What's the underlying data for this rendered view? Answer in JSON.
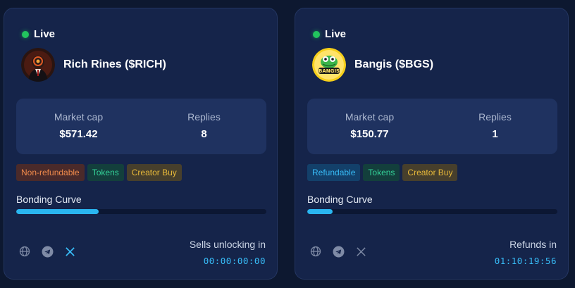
{
  "cards": [
    {
      "live_label": "Live",
      "name": "Rich Rines ($RICH)",
      "avatar_icon": "rich-rines-avatar",
      "stats": {
        "market_cap_label": "Market cap",
        "market_cap": "$571.42",
        "replies_label": "Replies",
        "replies": "8"
      },
      "tags": [
        {
          "label": "Non-refundable",
          "color": "#f08a4b"
        },
        {
          "label": "Tokens",
          "color": "#34d399"
        },
        {
          "label": "Creator Buy",
          "color": "#e8b93a"
        }
      ],
      "bonding_curve_label": "Bonding Curve",
      "bonding_curve_progress": 0.33,
      "socials": [
        "globe-icon",
        "telegram-icon",
        "x-icon"
      ],
      "x_icon_active": true,
      "timer_label": "Sells unlocking in",
      "timer": "00:00:00:00"
    },
    {
      "live_label": "Live",
      "name": "Bangis ($BGS)",
      "avatar_icon": "bangis-avatar",
      "avatar_text": "BANGIS",
      "stats": {
        "market_cap_label": "Market cap",
        "market_cap": "$150.77",
        "replies_label": "Replies",
        "replies": "1"
      },
      "tags": [
        {
          "label": "Refundable",
          "color": "#38bdf8"
        },
        {
          "label": "Tokens",
          "color": "#34d399"
        },
        {
          "label": "Creator Buy",
          "color": "#e8b93a"
        }
      ],
      "bonding_curve_label": "Bonding Curve",
      "bonding_curve_progress": 0.1,
      "socials": [
        "globe-icon",
        "telegram-icon",
        "x-icon"
      ],
      "x_icon_active": false,
      "timer_label": "Refunds in",
      "timer": "01:10:19:56"
    }
  ],
  "colors": {
    "live": "#22c55e",
    "accent": "#2ab6f0",
    "card_bg": "#15244a",
    "page_bg": "#0d1830"
  }
}
